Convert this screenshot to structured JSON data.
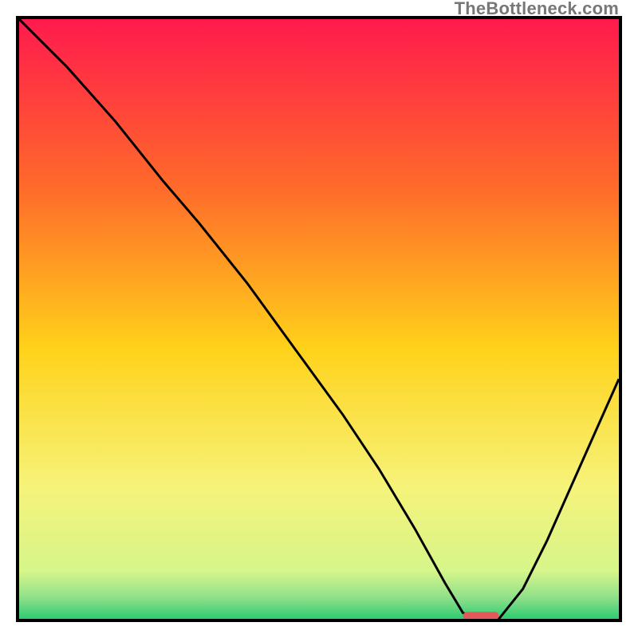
{
  "watermark": "TheBottleneck.com",
  "chart_data": {
    "type": "line",
    "title": "",
    "xlabel": "",
    "ylabel": "",
    "xlim": [
      0,
      100
    ],
    "ylim": [
      0,
      100
    ],
    "grid": false,
    "legend": false,
    "background": {
      "description": "vertical gradient implying bottleneck severity, red (top) to green (bottom)",
      "stops": [
        {
          "offset": 0.0,
          "color": "#ff1a4d"
        },
        {
          "offset": 0.28,
          "color": "#ff6a2a"
        },
        {
          "offset": 0.55,
          "color": "#ffd21a"
        },
        {
          "offset": 0.78,
          "color": "#f6f37a"
        },
        {
          "offset": 0.92,
          "color": "#d6f58a"
        },
        {
          "offset": 0.965,
          "color": "#8fe08a"
        },
        {
          "offset": 1.0,
          "color": "#2ecc71"
        }
      ]
    },
    "series": [
      {
        "name": "bottleneck-curve",
        "color": "#000000",
        "x": [
          0,
          8,
          16,
          24,
          30,
          38,
          46,
          54,
          60,
          66,
          71,
          74,
          77,
          80,
          84,
          88,
          92,
          96,
          100
        ],
        "y": [
          100,
          92,
          83,
          73,
          66,
          56,
          45,
          34,
          25,
          15,
          6,
          1,
          0,
          0,
          5,
          13,
          22,
          31,
          40
        ]
      }
    ],
    "marker": {
      "description": "red pill marker at curve minimum",
      "x": 77,
      "y": 0.5,
      "width": 6,
      "height": 1.3,
      "color": "#e05a5a"
    }
  }
}
